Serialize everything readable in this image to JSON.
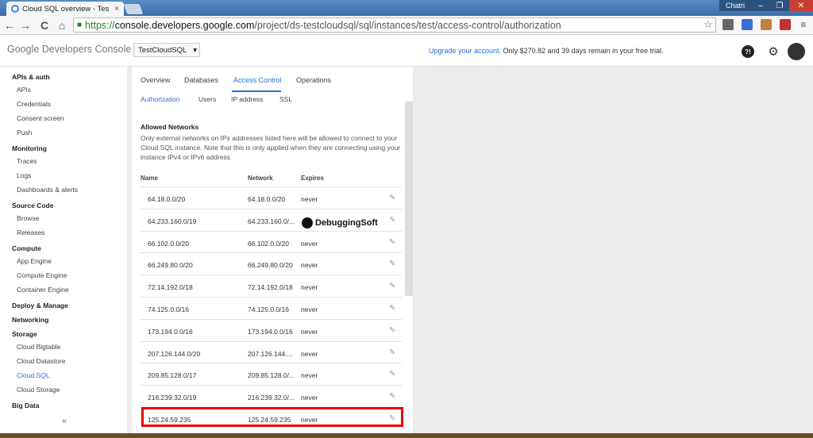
{
  "browser": {
    "tab_title": "Cloud SQL overview - Tes",
    "tab_close": "×",
    "user_chip": "Chatri",
    "min": "–",
    "max": "❐",
    "close": "✕",
    "url_scheme": "https://",
    "url_host": "console.developers.google.com",
    "url_path": "/project/ds-testcloudsql/sql/instances/test/access-control/authorization",
    "back": "←",
    "forward": "→",
    "reload": "C",
    "home": "⌂",
    "star": "☆"
  },
  "header": {
    "logo": "Google Developers Console",
    "project": "TestCloudSQL",
    "project_caret": "▾",
    "upgrade_link": "Upgrade your account.",
    "trial_text": " Only $270.82 and 39 days remain in your free trial.",
    "help_icon": "help-bubble-icon",
    "gear_glyph": "⚙",
    "help_glyph": "?!"
  },
  "sidebar": {
    "items": [
      {
        "label": "APIs & auth",
        "kind": "h"
      },
      {
        "label": "APIs",
        "kind": "i"
      },
      {
        "label": "Credentials",
        "kind": "i"
      },
      {
        "label": "Consent screen",
        "kind": "i"
      },
      {
        "label": "Push",
        "kind": "i"
      },
      {
        "label": "Monitoring",
        "kind": "h"
      },
      {
        "label": "Traces",
        "kind": "i"
      },
      {
        "label": "Logs",
        "kind": "i"
      },
      {
        "label": "Dashboards & alerts",
        "kind": "i"
      },
      {
        "label": "Source Code",
        "kind": "h"
      },
      {
        "label": "Browse",
        "kind": "i"
      },
      {
        "label": "Releases",
        "kind": "i"
      },
      {
        "label": "Compute",
        "kind": "h"
      },
      {
        "label": "App Engine",
        "kind": "i"
      },
      {
        "label": "Compute Engine",
        "kind": "i"
      },
      {
        "label": "Container Engine",
        "kind": "i"
      },
      {
        "label": "Deploy & Manage",
        "kind": "h"
      },
      {
        "label": "Networking",
        "kind": "h"
      },
      {
        "label": "Storage",
        "kind": "h"
      },
      {
        "label": "Cloud Bigtable",
        "kind": "i"
      },
      {
        "label": "Cloud Datastore",
        "kind": "i"
      },
      {
        "label": "Cloud SQL",
        "kind": "i",
        "active": true
      },
      {
        "label": "Cloud Storage",
        "kind": "i"
      },
      {
        "label": "Big Data",
        "kind": "h"
      }
    ],
    "collapse": "«"
  },
  "tabs": [
    "Overview",
    "Databases",
    "Access Control",
    "Operations"
  ],
  "subtabs": [
    "Authorization",
    "Users",
    "IP address",
    "SSL"
  ],
  "allowed_networks": {
    "title": "Allowed Networks",
    "description": "Only external networks on IPs addresses listed here will be allowed to connect to your Cloud SQL instance. Note that this is only applied when they are connecting using your instance IPv4 or IPv6 address",
    "col_name": "Name",
    "col_network": "Network",
    "col_expires": "Expires",
    "rows": [
      {
        "name": "64.18.0.0/20",
        "network": "64.18.0.0/20",
        "expires": "never"
      },
      {
        "name": "64.233.160.0/19",
        "network": "64.233.160.0/...",
        "expires": ""
      },
      {
        "name": "66.102.0.0/20",
        "network": "66.102.0.0/20",
        "expires": "never"
      },
      {
        "name": "66.249.80.0/20",
        "network": "66.249.80.0/20",
        "expires": "never"
      },
      {
        "name": "72.14.192.0/18",
        "network": "72.14.192.0/18",
        "expires": "never"
      },
      {
        "name": "74.125.0.0/16",
        "network": "74.125.0.0/16",
        "expires": "never"
      },
      {
        "name": "173.194.0.0/16",
        "network": "173.194.0.0/16",
        "expires": "never"
      },
      {
        "name": "207.126.144.0/20",
        "network": "207.126.144....",
        "expires": "never"
      },
      {
        "name": "209.85.128.0/17",
        "network": "209.85.128.0/...",
        "expires": "never"
      },
      {
        "name": "216.239.32.0/19",
        "network": "216.239.32.0/...",
        "expires": "never"
      },
      {
        "name": "125.24.59.235",
        "network": "125.24.59.235",
        "expires": "never"
      }
    ],
    "edit_glyph": "✎"
  },
  "watermark": "DebuggingSoft"
}
